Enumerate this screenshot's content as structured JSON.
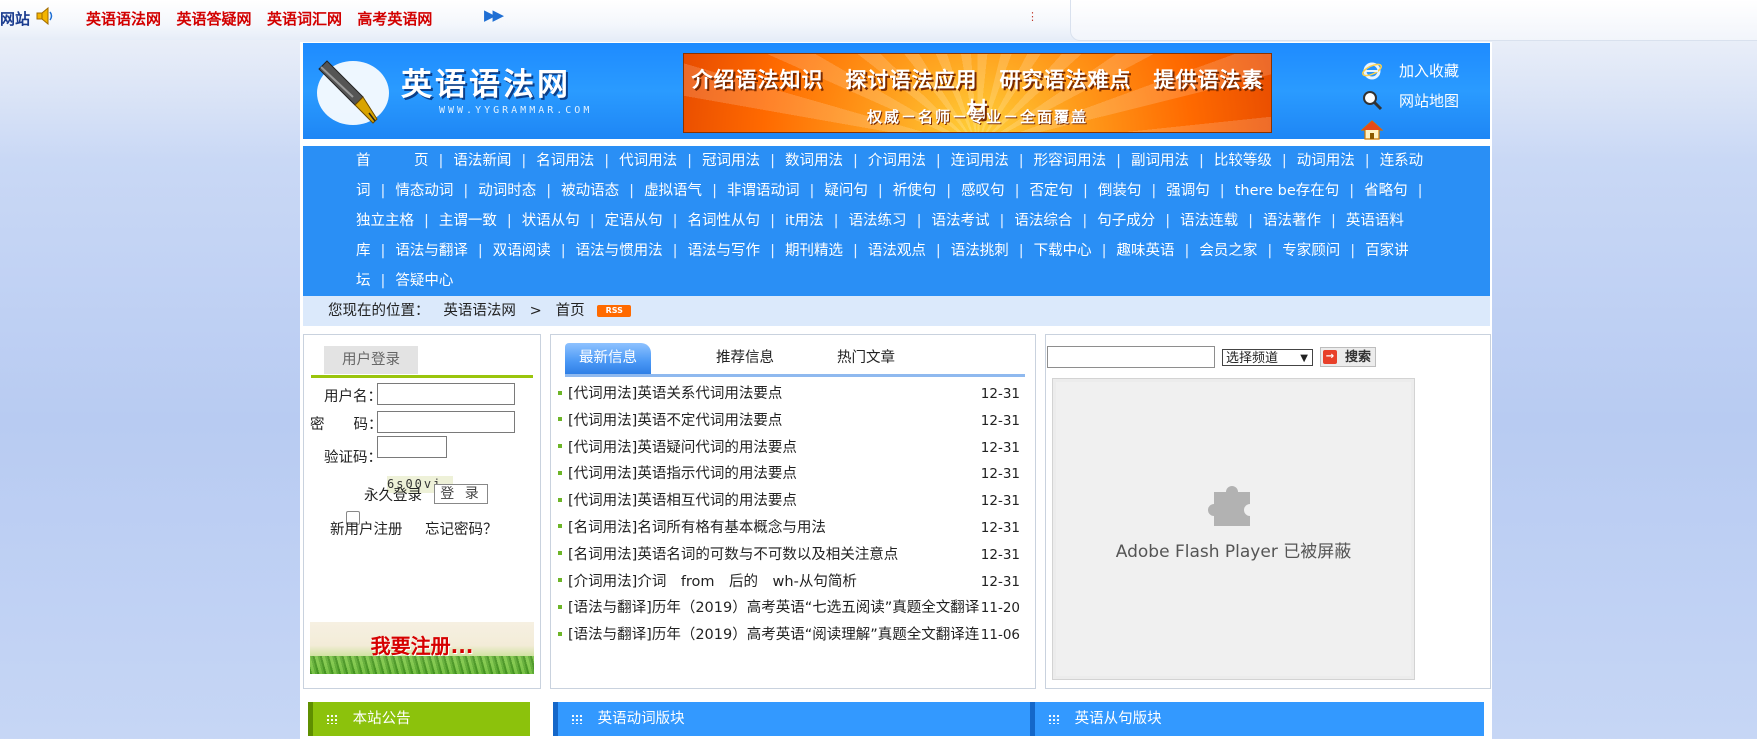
{
  "topbar": {
    "site_tag": "网站",
    "links": [
      "英语语法网",
      "英语答疑网",
      "英语词汇网",
      "高考英语网"
    ]
  },
  "header": {
    "logo_title": "英语语法网",
    "logo_url": "WWW.YYGRAMMAR.COM",
    "banner_line1": "介绍语法知识　探讨语法应用　研究语法难点　提供语法素材",
    "banner_line2": "权威－名师－专业－全面覆盖",
    "quick_links": [
      "加入收藏",
      "网站地图"
    ]
  },
  "nav": {
    "items": [
      "首　　　页",
      "语法新闻",
      "名词用法",
      "代词用法",
      "冠词用法",
      "数词用法",
      "介词用法",
      "连词用法",
      "形容词用法",
      "副词用法",
      "比较等级",
      "动词用法",
      "连系动词",
      "情态动词",
      "动词时态",
      "被动语态",
      "虚拟语气",
      "非谓语动词",
      "疑问句",
      "祈使句",
      "感叹句",
      "否定句",
      "倒装句",
      "强调句",
      "there be存在句",
      "省略句",
      "独立主格",
      "主谓一致",
      "状语从句",
      "定语从句",
      "名词性从句",
      "it用法",
      "语法练习",
      "语法考试",
      "语法综合",
      "句子成分",
      "语法连载",
      "语法著作",
      "英语语料库",
      "语法与翻译",
      "双语阅读",
      "语法与惯用法",
      "语法与写作",
      "期刊精选",
      "语法观点",
      "语法挑刺",
      "下载中心",
      "趣味英语",
      "会员之家",
      "专家顾问",
      "百家讲坛",
      "答疑中心"
    ]
  },
  "location": {
    "label": "您现在的位置：",
    "crumb_site": "英语语法网",
    "crumb_sep": ">",
    "crumb_page": "首页",
    "rss": "RSS"
  },
  "login": {
    "tab": "用户登录",
    "username_label": "用户名：",
    "password_label": "密　　码：",
    "captcha_label": "验证码：",
    "captcha_value": "6s00vi",
    "remember_label": "永久登录",
    "login_button": "登 录",
    "register_link": "新用户注册",
    "forgot_link": "忘记密码？",
    "register_banner": "我要注册..."
  },
  "news": {
    "tabs": [
      "最新信息",
      "推荐信息",
      "热门文章"
    ],
    "items": [
      {
        "title": "[代词用法]英语关系代词用法要点",
        "date": "12-31"
      },
      {
        "title": "[代词用法]英语不定代词用法要点",
        "date": "12-31"
      },
      {
        "title": "[代词用法]英语疑问代词的用法要点",
        "date": "12-31"
      },
      {
        "title": "[代词用法]英语指示代词的用法要点",
        "date": "12-31"
      },
      {
        "title": "[代词用法]英语相互代词的用法要点",
        "date": "12-31"
      },
      {
        "title": "[名词用法]名词所有格有基本概念与用法",
        "date": "12-31"
      },
      {
        "title": "[名词用法]英语名词的可数与不可数以及相关注意点",
        "date": "12-31"
      },
      {
        "title": "[介词用法]介词　from　后的　wh-从句简析",
        "date": "12-31"
      },
      {
        "title": "[语法与翻译]历年（2019）高考英语“七选五阅读”真题全文翻译",
        "date": "11-20"
      },
      {
        "title": "[语法与翻译]历年（2019）高考英语“阅读理解”真题全文翻译连",
        "date": "11-06"
      }
    ]
  },
  "search": {
    "select_label": "选择频道",
    "button_label": "搜索",
    "flash_message": "Adobe Flash Player 已被屏蔽"
  },
  "sections": {
    "notice": "本站公告",
    "verbs": "英语动词版块",
    "clauses": "英语从句版块"
  },
  "colors": {
    "header_blue": "#1e8bff",
    "nav_blue": "#2a8ff5",
    "topbar_red": "#d20000",
    "accent_green": "#9ac50c",
    "banner_orange": "#ff6a00"
  }
}
